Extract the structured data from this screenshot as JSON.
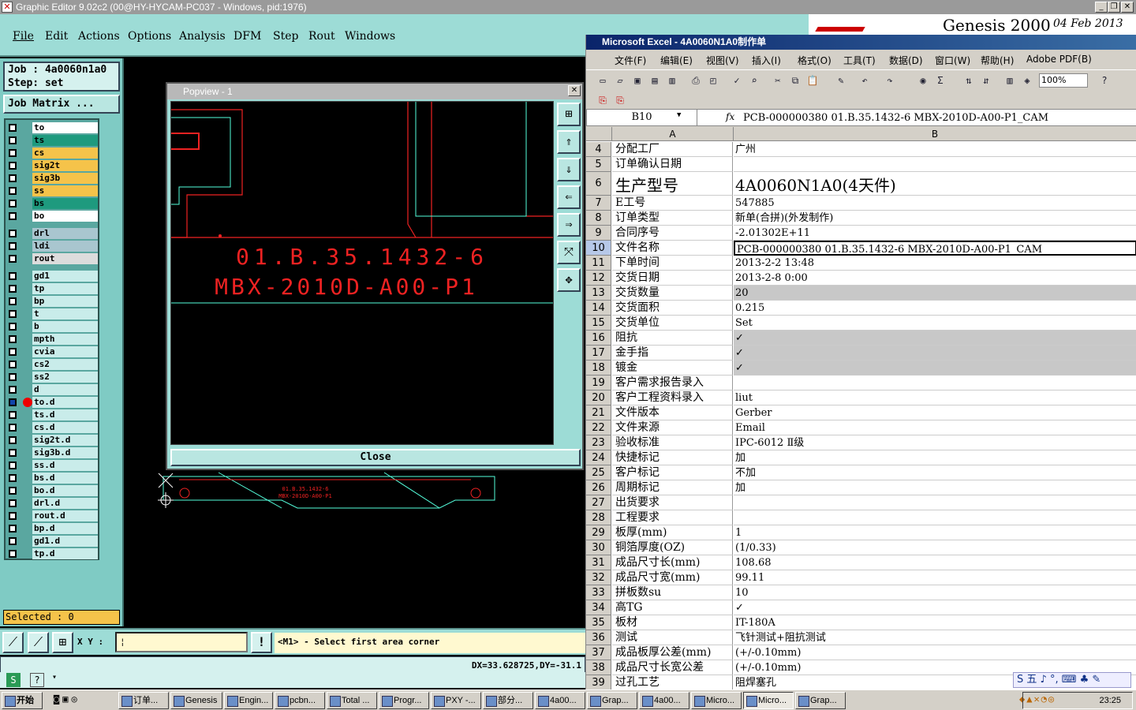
{
  "app": {
    "title": "Graphic Editor 9.02c2 (00@HY-HYCAM-PC037 - Windows, pid:1976)",
    "menu": [
      "File",
      "Edit",
      "Actions",
      "Options",
      "Analysis",
      "DFM",
      "Step",
      "Rout",
      "Windows"
    ],
    "banner": {
      "name": "Genesis 2000",
      "date": "04 Feb 2013"
    }
  },
  "job": {
    "job_label": "Job : 4a0060n1a0",
    "step_label": "Step: set",
    "matrix_button": "Job Matrix ..."
  },
  "layers": [
    {
      "name": "to",
      "color": "#ffffff"
    },
    {
      "name": "ts",
      "color": "#1e9a7e"
    },
    {
      "name": "cs",
      "color": "#f5c34a"
    },
    {
      "name": "sig2t",
      "color": "#f5c34a"
    },
    {
      "name": "sig3b",
      "color": "#f5c34a"
    },
    {
      "name": "ss",
      "color": "#f5c34a"
    },
    {
      "name": "bs",
      "color": "#1e9a7e"
    },
    {
      "name": "bo",
      "color": "#ffffff"
    },
    {
      "name": "drl",
      "color": "#a9c6cf"
    },
    {
      "name": "ldi",
      "color": "#a9c6cf"
    },
    {
      "name": "rout",
      "color": "#dcdcdc"
    },
    {
      "name": "gd1",
      "color": "#c9ecea"
    },
    {
      "name": "tp",
      "color": "#c9ecea"
    },
    {
      "name": "bp",
      "color": "#c9ecea"
    },
    {
      "name": "t",
      "color": "#c9ecea"
    },
    {
      "name": "b",
      "color": "#c9ecea"
    },
    {
      "name": "mpth",
      "color": "#c9ecea"
    },
    {
      "name": "cvia",
      "color": "#c9ecea"
    },
    {
      "name": "cs2",
      "color": "#c9ecea"
    },
    {
      "name": "ss2",
      "color": "#c9ecea"
    },
    {
      "name": "d",
      "color": "#c9ecea"
    },
    {
      "name": "to.d",
      "color": "#c9ecea"
    },
    {
      "name": "ts.d",
      "color": "#c9ecea"
    },
    {
      "name": "cs.d",
      "color": "#c9ecea"
    },
    {
      "name": "sig2t.d",
      "color": "#c9ecea"
    },
    {
      "name": "sig3b.d",
      "color": "#c9ecea"
    },
    {
      "name": "ss.d",
      "color": "#c9ecea"
    },
    {
      "name": "bs.d",
      "color": "#c9ecea"
    },
    {
      "name": "bo.d",
      "color": "#c9ecea"
    },
    {
      "name": "drl.d",
      "color": "#c9ecea"
    },
    {
      "name": "rout.d",
      "color": "#c9ecea"
    },
    {
      "name": "bp.d",
      "color": "#c9ecea"
    },
    {
      "name": "gd1.d",
      "color": "#c9ecea"
    },
    {
      "name": "tp.d",
      "color": "#c9ecea"
    }
  ],
  "selected": "Selected : 0",
  "coords": {
    "xy_label": "X Y :",
    "message": "<M1> - Select first area corner",
    "status": "DX=33.628725,DY=-31.1"
  },
  "popview": {
    "title": "Popview - 1",
    "text_line1": "01.B.35.1432-6",
    "text_line2": "MBX-2010D-A00-P1",
    "close_label": "Close"
  },
  "excel": {
    "title": "Microsoft Excel - 4A0060N1A0制作单",
    "menu": [
      "文件(F)",
      "编辑(E)",
      "视图(V)",
      "插入(I)",
      "格式(O)",
      "工具(T)",
      "数据(D)",
      "窗口(W)",
      "帮助(H)",
      "Adobe PDF(B)"
    ],
    "zoom": "100%",
    "namebox": "B10",
    "fx": "fx",
    "formula": "PCB-000000380 01.B.35.1432-6 MBX-2010D-A00-P1_CAM",
    "col_a": "A",
    "col_b": "B",
    "rows": [
      {
        "n": "4",
        "a": "分配工厂",
        "b": "广州"
      },
      {
        "n": "5",
        "a": "订单确认日期",
        "b": ""
      },
      {
        "n": "6",
        "a": "生产型号",
        "b": "4A0060N1A0(4天件)"
      },
      {
        "n": "7",
        "a": "E工号",
        "b": "547885"
      },
      {
        "n": "8",
        "a": "订单类型",
        "b": "新单(合拼)(外发制作)"
      },
      {
        "n": "9",
        "a": "合同序号",
        "b": "-2.01302E+11"
      },
      {
        "n": "10",
        "a": "文件名称",
        "b": "PCB-000000380 01.B.35.1432-6 MBX-2010D-A00-P1_CAM"
      },
      {
        "n": "11",
        "a": "下单时间",
        "b": "2013-2-2 13:48"
      },
      {
        "n": "12",
        "a": "交货日期",
        "b": "2013-2-8 0:00"
      },
      {
        "n": "13",
        "a": "交货数量",
        "b": "20"
      },
      {
        "n": "14",
        "a": "交货面积",
        "b": "0.215"
      },
      {
        "n": "15",
        "a": "交货单位",
        "b": "Set"
      },
      {
        "n": "16",
        "a": "阻抗",
        "b": "✓"
      },
      {
        "n": "17",
        "a": "金手指",
        "b": "✓"
      },
      {
        "n": "18",
        "a": "镀金",
        "b": "✓"
      },
      {
        "n": "19",
        "a": "客户需求报告录入",
        "b": ""
      },
      {
        "n": "20",
        "a": "客户工程资料录入",
        "b": "liut"
      },
      {
        "n": "21",
        "a": "文件版本",
        "b": "Gerber"
      },
      {
        "n": "22",
        "a": "文件来源",
        "b": "Email"
      },
      {
        "n": "23",
        "a": "验收标准",
        "b": "IPC-6012 Ⅱ级"
      },
      {
        "n": "24",
        "a": "快捷标记",
        "b": "加"
      },
      {
        "n": "25",
        "a": "客户标记",
        "b": "不加"
      },
      {
        "n": "26",
        "a": "周期标记",
        "b": "加"
      },
      {
        "n": "27",
        "a": "出货要求",
        "b": ""
      },
      {
        "n": "28",
        "a": "工程要求",
        "b": ""
      },
      {
        "n": "29",
        "a": "板厚(mm)",
        "b": "1"
      },
      {
        "n": "30",
        "a": "铜箔厚度(OZ)",
        "b": "(1/0.33)"
      },
      {
        "n": "31",
        "a": "成品尺寸长(mm)",
        "b": "108.68"
      },
      {
        "n": "32",
        "a": "成品尺寸宽(mm)",
        "b": "99.11"
      },
      {
        "n": "33",
        "a": "拼板数su",
        "b": "10"
      },
      {
        "n": "34",
        "a": "高TG",
        "b": "✓"
      },
      {
        "n": "35",
        "a": "板材",
        "b": "IT-180A"
      },
      {
        "n": "36",
        "a": "测试",
        "b": "飞针测试+阻抗测试"
      },
      {
        "n": "37",
        "a": "成品板厚公差(mm)",
        "b": "(+/-0.10mm)"
      },
      {
        "n": "38",
        "a": "成品尺寸长宽公差",
        "b": "(+/-0.10mm)"
      },
      {
        "n": "39",
        "a": "过孔工艺",
        "b": "阻焊塞孔"
      }
    ]
  },
  "ime": "S 五 ♪ °, ⌨ ♣ ✎",
  "taskbar": {
    "start": "开始",
    "tasks": [
      "订单...",
      "Genesis",
      "Engin...",
      "pcbn...",
      "Total ...",
      "Progr...",
      "PXY -...",
      "部分...",
      "4a00...",
      "Grap...",
      "4a00...",
      "Micro...",
      "Micro...",
      "Grap..."
    ],
    "clock": "23:25"
  }
}
